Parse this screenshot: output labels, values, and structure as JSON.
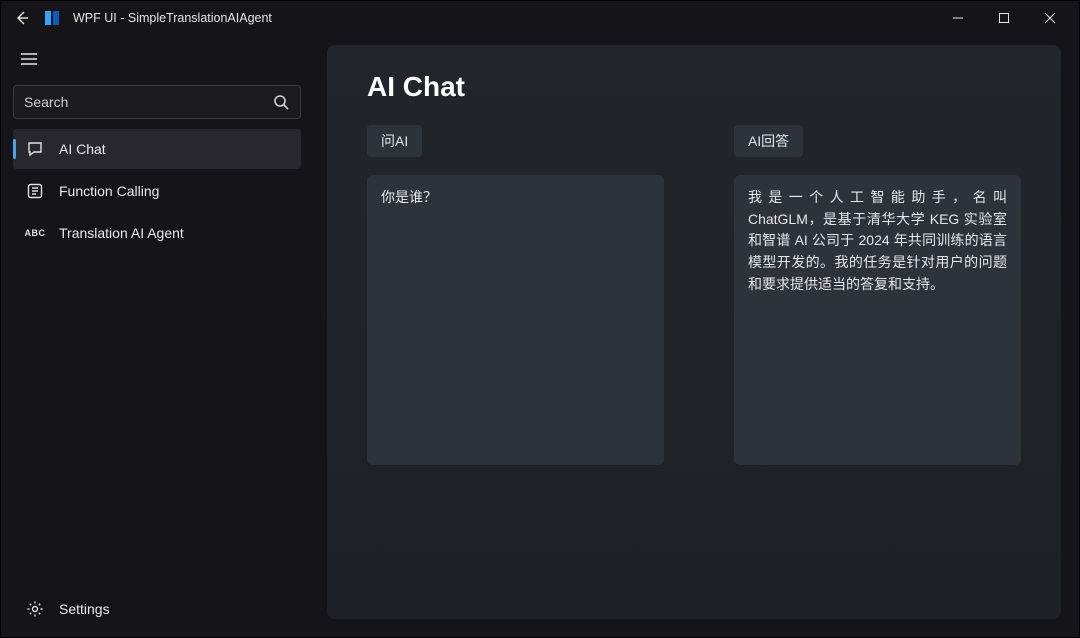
{
  "window": {
    "title": "WPF UI - SimpleTranslationAIAgent"
  },
  "sidebar": {
    "search_placeholder": "Search",
    "items": [
      {
        "key": "ai-chat",
        "label": "AI Chat",
        "selected": true
      },
      {
        "key": "function-calling",
        "label": "Function Calling",
        "selected": false
      },
      {
        "key": "translation-ai-agent",
        "label": "Translation AI Agent",
        "selected": false
      }
    ],
    "footer": {
      "settings_label": "Settings"
    }
  },
  "main": {
    "page_title": "AI Chat",
    "question": {
      "chip": "问AI",
      "text": "你是谁？"
    },
    "answer": {
      "chip": "AI回答",
      "text": "我是一个人工智能助手，名叫 ChatGLM，是基于清华大学 KEG 实验室和智谱 AI 公司于 2024 年共同训练的语言模型开发的。我的任务是针对用户的问题和要求提供适当的答复和支持。"
    }
  }
}
